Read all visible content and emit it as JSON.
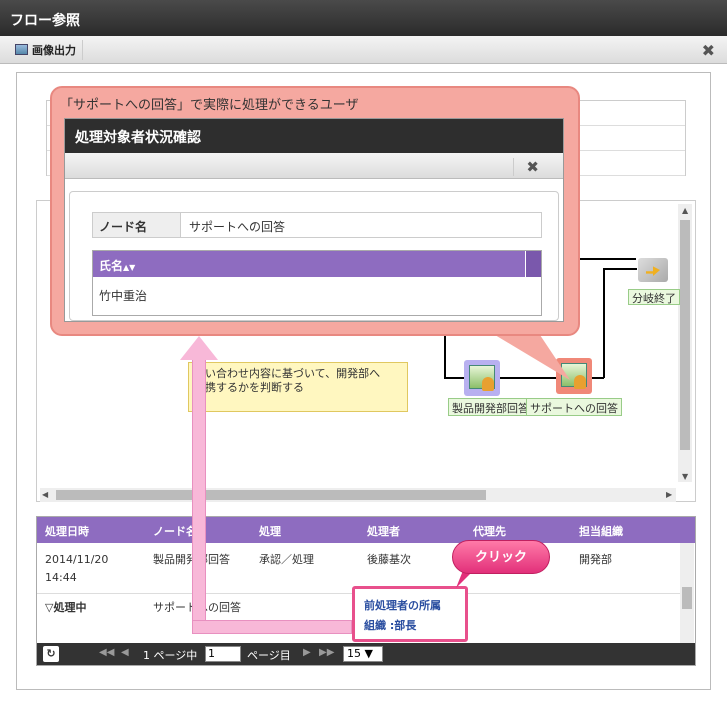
{
  "window": {
    "title": "フロー参照"
  },
  "toolbar": {
    "image_output": "画像出力",
    "close_icon": "close-icon",
    "image_icon": "image-icon"
  },
  "diagram": {
    "note_line1": "い合わせ内容に基づいて、開発部へ",
    "note_line2": "携するかを判断する",
    "node1_label": "製品開発部回答",
    "node2_label": "サポートへの回答",
    "branch_label": "分岐終了"
  },
  "grid": {
    "headers": [
      "処理日時",
      "ノード名",
      "処理",
      "処理者",
      "代理先",
      "担当組織"
    ],
    "rows": [
      {
        "date1": "2014/11/20",
        "date2": "14:44",
        "node": "製品開発部回答",
        "action": "承認／処理",
        "user": "後藤基次",
        "proxy": "",
        "org": "開発部"
      },
      {
        "date1": "▽処理中",
        "node": "サポートへの回答",
        "action": "",
        "user_line1": "前処理者の所属",
        "user_line2": "組織 :部長",
        "proxy": "",
        "org": ""
      }
    ],
    "pager": {
      "page_prefix": "1 ページ中",
      "page_value": "1",
      "page_suffix": "ページ目",
      "per_page": "15 ▼"
    }
  },
  "callout": {
    "caption": "「サポートへの回答」で実際に処理ができるユーザ",
    "dialog_title": "処理対象者状況確認",
    "node_key": "ノード名",
    "node_value": "サポートへの回答",
    "name_header": "氏名",
    "sort_icon": "▲▼",
    "name_row": "竹中重治"
  },
  "click_badge": "クリック"
}
